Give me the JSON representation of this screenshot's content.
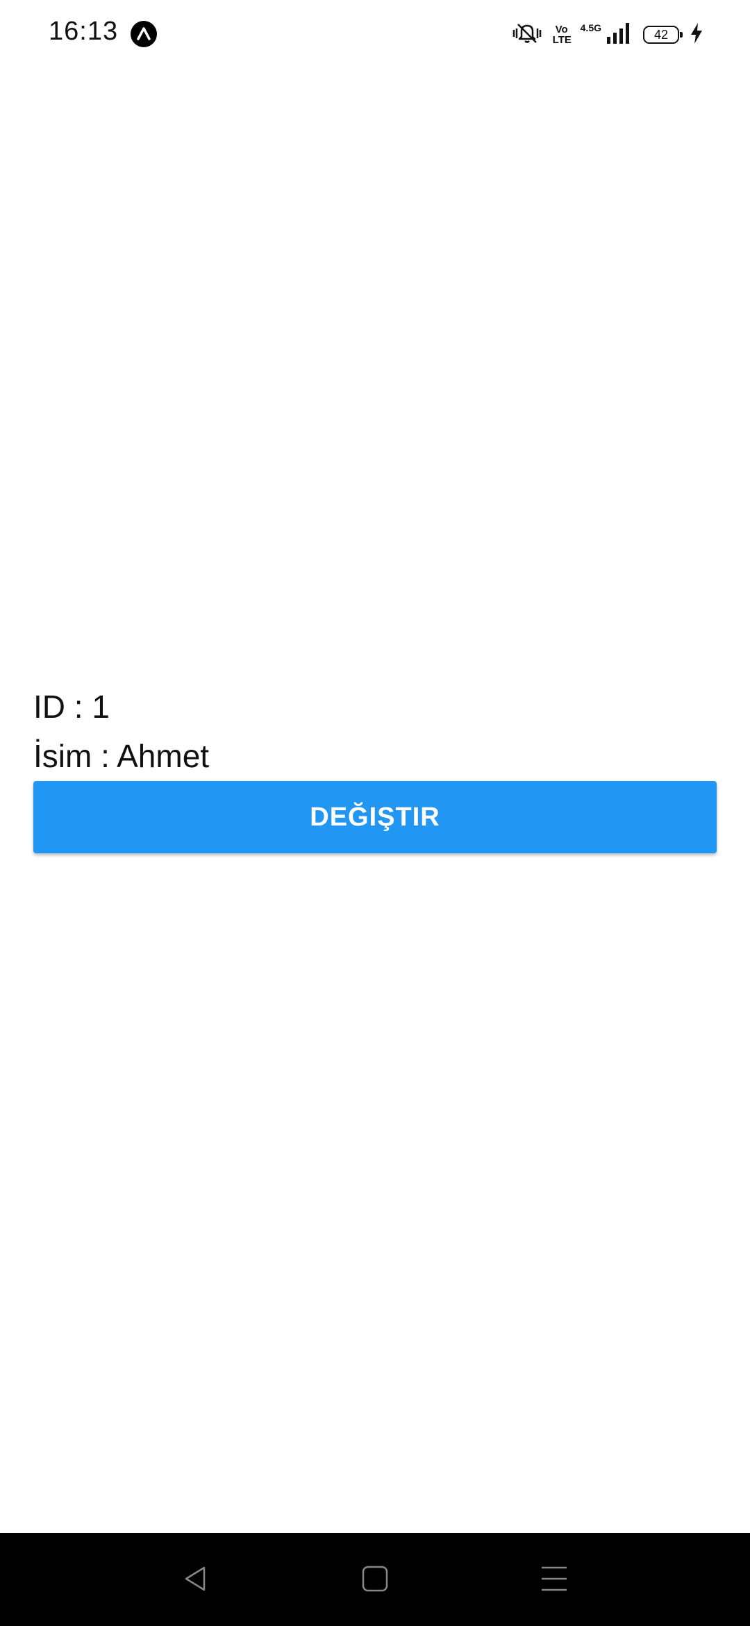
{
  "status_bar": {
    "time": "16:13",
    "app_icon": "expo-icon",
    "icons": [
      "vibrate-icon",
      "volte-icon",
      "signal-icon",
      "battery-icon",
      "charging-icon"
    ],
    "volte_text": "Vo LTE",
    "network_type": "4.5G",
    "battery_level": "42"
  },
  "content": {
    "id_text": "ID : 1",
    "name_text": "İsim : Ahmet",
    "button_label": "DEĞIŞTIR"
  },
  "nav_bar": {
    "icons": [
      "back-icon",
      "home-icon",
      "recents-icon"
    ]
  },
  "colors": {
    "button_bg": "#2196F3",
    "button_text": "#FFFFFF",
    "nav_bg": "#000000",
    "text": "#111111"
  }
}
